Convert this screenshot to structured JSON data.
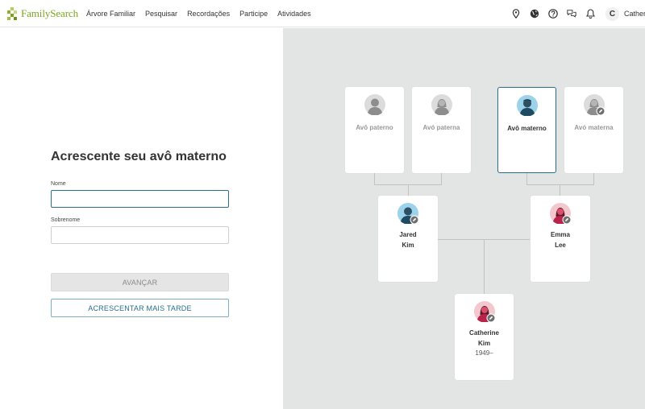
{
  "header": {
    "logo_text": "FamilySearch",
    "nav": [
      "Árvore Familiar",
      "Pesquisar",
      "Recordações",
      "Participe",
      "Atividades"
    ],
    "icons": [
      "location-pin-icon",
      "globe-icon",
      "help-icon",
      "messages-icon",
      "bell-icon"
    ],
    "avatar_letter": "C",
    "user_name": "Catherine"
  },
  "form": {
    "title": "Acrescente seu avô materno",
    "first_name_label": "Nome",
    "first_name_value": "",
    "last_name_label": "Sobrenome",
    "last_name_value": "",
    "next_button": "AVANÇAR",
    "later_button": "ACRESCENTAR MAIS TARDE"
  },
  "tree": {
    "paternal_grandfather": "Avô paterno",
    "paternal_grandmother": "Avó paterna",
    "maternal_grandfather": "Avô materno",
    "maternal_grandmother": "Avó materna",
    "father_first": "Jared",
    "father_last": "Kim",
    "mother_first": "Emma",
    "mother_last": "Lee",
    "self_first": "Catherine",
    "self_last": "Kim",
    "self_years": "1949–"
  },
  "colors": {
    "accent": "#2a6f8e",
    "brand_green": "#7aa51c",
    "panel_gray": "#e3e4e4",
    "female_avatar_bg": "#f4c7cf",
    "male_avatar_bg": "#9dd3ea"
  }
}
